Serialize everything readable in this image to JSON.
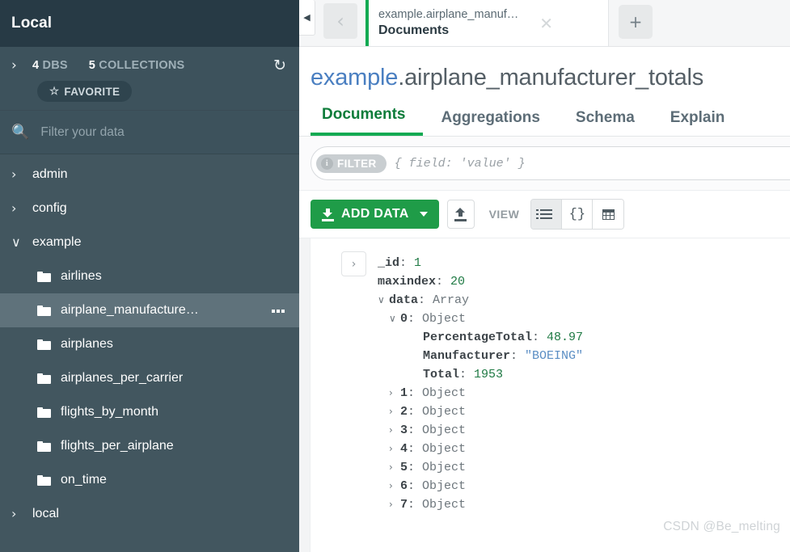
{
  "sidebar": {
    "title": "Local",
    "stats": {
      "caret": "›",
      "db_count": "4",
      "db_label": "DBS",
      "collection_count": "5",
      "collection_label": "COLLECTIONS",
      "refresh_icon": "refresh-icon",
      "favorite_label": "FAVORITE",
      "favorite_star": "☆"
    },
    "search": {
      "icon": "search-icon",
      "placeholder": "Filter your data",
      "value": ""
    },
    "tree": [
      {
        "type": "db",
        "label": "admin",
        "caret": "›",
        "expanded": false
      },
      {
        "type": "db",
        "label": "config",
        "caret": "›",
        "expanded": false
      },
      {
        "type": "db",
        "label": "example",
        "caret": "∨",
        "expanded": true
      },
      {
        "type": "collection",
        "label": "airlines",
        "selected": false
      },
      {
        "type": "collection",
        "label": "airplane_manufacture…",
        "selected": true
      },
      {
        "type": "collection",
        "label": "airplanes",
        "selected": false
      },
      {
        "type": "collection",
        "label": "airplanes_per_carrier",
        "selected": false
      },
      {
        "type": "collection",
        "label": "flights_by_month",
        "selected": false
      },
      {
        "type": "collection",
        "label": "flights_per_airplane",
        "selected": false
      },
      {
        "type": "collection",
        "label": "on_time",
        "selected": false
      },
      {
        "type": "db",
        "label": "local",
        "caret": "›",
        "expanded": false
      }
    ]
  },
  "tabbar": {
    "collapse_icon": "◀",
    "back_icon": "‹",
    "tab": {
      "namespace": "example.airplane_manuf…",
      "subtitle": "Documents",
      "close_icon": "✕",
      "accent_color": "#13aa52"
    },
    "new_tab_icon": "+"
  },
  "collection": {
    "db_name": "example",
    "separator": ".",
    "collection_name": "airplane_manufacturer_totals",
    "tabs": [
      {
        "label": "Documents",
        "active": true
      },
      {
        "label": "Aggregations",
        "active": false
      },
      {
        "label": "Schema",
        "active": false
      },
      {
        "label": "Explain",
        "active": false
      }
    ]
  },
  "filter": {
    "badge_label": "FILTER",
    "info_icon": "i",
    "placeholder": "{ field: 'value' }",
    "value": ""
  },
  "toolbar": {
    "add_data_label": "ADD DATA",
    "add_data_icon": "download-icon",
    "add_data_caret": "▼",
    "export_icon": "upload-icon",
    "view_label": "VIEW",
    "views": [
      {
        "name": "list-view",
        "icon": "list-icon",
        "active": true
      },
      {
        "name": "json-view",
        "icon": "braces-icon",
        "label": "{}",
        "active": false
      },
      {
        "name": "table-view",
        "icon": "table-grid-icon",
        "active": false
      }
    ]
  },
  "document": {
    "expand_icon": "›",
    "fields": [
      {
        "indent": 0,
        "caret": "",
        "key": "_id",
        "value": "1",
        "vtype": "num"
      },
      {
        "indent": 0,
        "caret": "",
        "key": "maxindex",
        "value": "20",
        "vtype": "num"
      },
      {
        "indent": 0,
        "caret": "∨",
        "key": "data",
        "value": "Array",
        "vtype": "type"
      },
      {
        "indent": 1,
        "caret": "∨",
        "key": "0",
        "value": "Object",
        "vtype": "type"
      },
      {
        "indent": 3,
        "caret": "",
        "key": "PercentageTotal",
        "value": "48.97",
        "vtype": "num"
      },
      {
        "indent": 3,
        "caret": "",
        "key": "Manufacturer",
        "value": "\"BOEING\"",
        "vtype": "str"
      },
      {
        "indent": 3,
        "caret": "",
        "key": "Total",
        "value": "1953",
        "vtype": "num"
      },
      {
        "indent": 1,
        "caret": "›",
        "key": "1",
        "value": "Object",
        "vtype": "type"
      },
      {
        "indent": 1,
        "caret": "›",
        "key": "2",
        "value": "Object",
        "vtype": "type"
      },
      {
        "indent": 1,
        "caret": "›",
        "key": "3",
        "value": "Object",
        "vtype": "type"
      },
      {
        "indent": 1,
        "caret": "›",
        "key": "4",
        "value": "Object",
        "vtype": "type"
      },
      {
        "indent": 1,
        "caret": "›",
        "key": "5",
        "value": "Object",
        "vtype": "type"
      },
      {
        "indent": 1,
        "caret": "›",
        "key": "6",
        "value": "Object",
        "vtype": "type"
      },
      {
        "indent": 1,
        "caret": "›",
        "key": "7",
        "value": "Object",
        "vtype": "type"
      }
    ]
  },
  "watermark": "CSDN @Be_melting",
  "colors": {
    "sidebar_bg": "#42565f",
    "sidebar_header_bg": "#273a45",
    "accent_green": "#13aa52",
    "add_data_green": "#1f9c48",
    "db_link_blue": "#4a7fc1",
    "json_number_green": "#1f7a44",
    "json_string_blue": "#5b8ec4"
  }
}
